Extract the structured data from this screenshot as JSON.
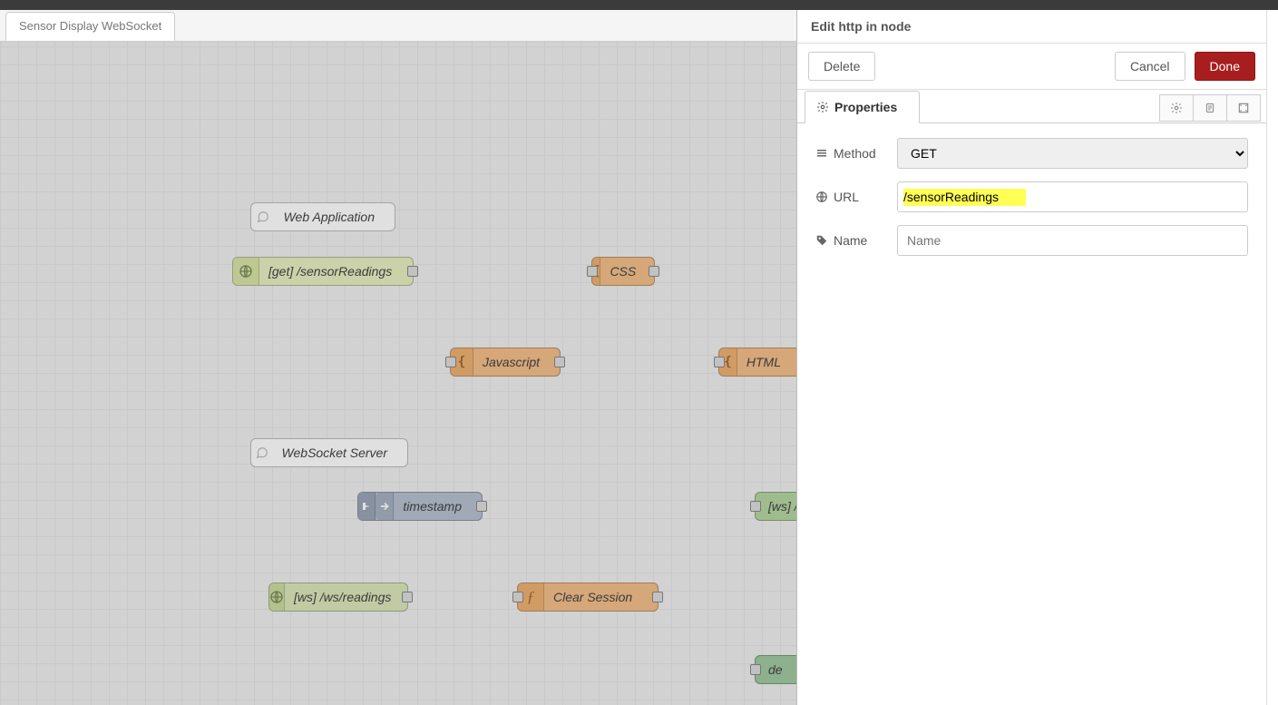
{
  "tab": {
    "label": "Sensor Display WebSocket"
  },
  "nodes": {
    "comment_web": "Web Application",
    "http_in": "[get] /sensorReadings",
    "css": "CSS",
    "javascript": "Javascript",
    "html": "HTML",
    "comment_ws": "WebSocket Server",
    "inject": "timestamp",
    "ws_in": "[ws] /ws/readings",
    "func": "Clear Session",
    "ws_out": "[ws] /",
    "debug": "de"
  },
  "panel": {
    "title": "Edit http in node",
    "delete": "Delete",
    "cancel": "Cancel",
    "done": "Done",
    "tab_properties": "Properties",
    "method_label": "Method",
    "method_value": "GET",
    "url_label": "URL",
    "url_value": "/sensorReadings",
    "name_label": "Name",
    "name_placeholder": "Name"
  },
  "colors": {
    "accent": "#a81e1e",
    "highlight": "#ffff55"
  }
}
